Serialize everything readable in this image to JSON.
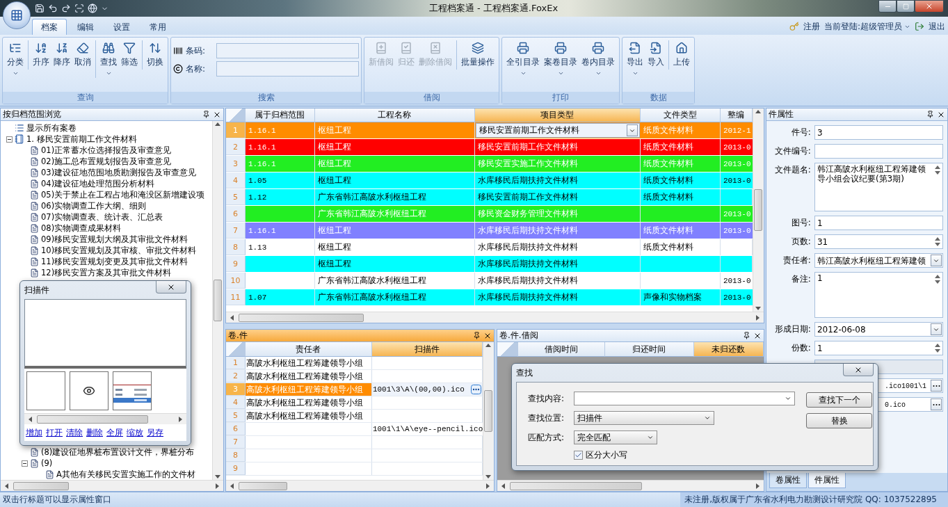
{
  "window": {
    "title": "工程档案通 - 工程档案通.FoxEx"
  },
  "ribbon": {
    "tabs": [
      {
        "label": "档案",
        "selected": true
      },
      {
        "label": "编辑",
        "selected": false
      },
      {
        "label": "设置",
        "selected": false
      },
      {
        "label": "常用",
        "selected": false
      }
    ],
    "user_bar": {
      "register": "注册",
      "login": "当前登陆:超级管理员",
      "logout": "退出"
    },
    "groups": [
      {
        "title": "查询",
        "kind": "buttons",
        "buttons": [
          {
            "label": "分类",
            "dropdown": true,
            "disabled": false,
            "separated": false
          },
          {
            "label": "升序",
            "dropdown": false,
            "disabled": false,
            "separated": true
          },
          {
            "label": "降序",
            "dropdown": false,
            "disabled": false,
            "separated": false
          },
          {
            "label": "取消",
            "dropdown": false,
            "disabled": false,
            "separated": false
          },
          {
            "label": "查找",
            "dropdown": true,
            "disabled": false,
            "separated": true
          },
          {
            "label": "筛选",
            "dropdown": false,
            "disabled": false,
            "separated": false
          },
          {
            "label": "切换",
            "dropdown": false,
            "disabled": false,
            "separated": true
          }
        ]
      },
      {
        "title": "搜索",
        "kind": "fields",
        "fields": [
          {
            "label": "条码:"
          },
          {
            "label": "名称:"
          }
        ]
      },
      {
        "title": "借阅",
        "kind": "buttons",
        "buttons": [
          {
            "label": "新借阅",
            "dropdown": false,
            "disabled": true,
            "separated": false
          },
          {
            "label": "归还",
            "dropdown": false,
            "disabled": true,
            "separated": false
          },
          {
            "label": "删除借阅",
            "dropdown": false,
            "disabled": true,
            "separated": false
          },
          {
            "label": "批量操作",
            "dropdown": false,
            "disabled": false,
            "separated": true
          }
        ]
      },
      {
        "title": "打印",
        "kind": "buttons",
        "buttons": [
          {
            "label": "全引目录",
            "dropdown": true,
            "disabled": false,
            "separated": false
          },
          {
            "label": "案卷目录",
            "dropdown": true,
            "disabled": false,
            "separated": false
          },
          {
            "label": "卷内目录",
            "dropdown": true,
            "disabled": false,
            "separated": false
          }
        ]
      },
      {
        "title": "数据",
        "kind": "buttons",
        "buttons": [
          {
            "label": "导出",
            "dropdown": true,
            "disabled": false,
            "separated": false
          },
          {
            "label": "导入",
            "dropdown": false,
            "disabled": false,
            "separated": false
          },
          {
            "label": "上传",
            "dropdown": false,
            "disabled": false,
            "separated": true
          }
        ]
      }
    ]
  },
  "tree": {
    "title": "按归档范围浏览",
    "items": [
      {
        "label": "显示所有案卷",
        "kind": "root"
      },
      {
        "label": "1.  移民安置前期工作文件材料",
        "kind": "folder",
        "expanded": true,
        "children": [
          {
            "label": "01)正常蓄水位选择报告及审查意见",
            "kind": "doc"
          },
          {
            "label": "02)施工总布置规划报告及审查意见",
            "kind": "doc"
          },
          {
            "label": "03)建设征地范围地质勘测报告及审查意见",
            "kind": "doc"
          },
          {
            "label": "04)建设征地处理范围分析材料",
            "kind": "doc"
          },
          {
            "label": "05)关于禁止在工程占地和淹没区新增建设项",
            "kind": "doc"
          },
          {
            "label": "06)实物调查工作大纲、细则",
            "kind": "doc"
          },
          {
            "label": "07)实物调查表、统计表、汇总表",
            "kind": "doc"
          },
          {
            "label": "08)实物调查成果材料",
            "kind": "doc"
          },
          {
            "label": "09)移民安置规划大纲及其审批文件材料",
            "kind": "doc"
          },
          {
            "label": "10)移民安置规划及其审核、审批文件材料",
            "kind": "doc"
          },
          {
            "label": "11)移民安置规划变更及其审批文件材料",
            "kind": "doc"
          },
          {
            "label": "12)移民安置方案及其审批文件材料",
            "kind": "doc"
          }
        ]
      }
    ],
    "lower_items": [
      {
        "label": "(8)建设征地界桩布置设计文件，界桩分布",
        "kind": "doc"
      },
      {
        "label": "(9)",
        "kind": "doc",
        "expanded": true,
        "children": [
          {
            "label": "A其他有关移民安置实施工作的文件材",
            "kind": "doc"
          }
        ]
      }
    ]
  },
  "scan_window": {
    "title": "扫描件",
    "thumbnails": [
      {
        "kind": "blank"
      },
      {
        "kind": "icon"
      },
      {
        "kind": "picture"
      }
    ],
    "links": [
      "增加",
      "打开",
      "清除",
      "删除",
      "全屏",
      "缩放",
      "另存"
    ]
  },
  "grid": {
    "columns": [
      {
        "label": "属于归档范围",
        "selected": false
      },
      {
        "label": "工程名称",
        "selected": false
      },
      {
        "label": "项目类型",
        "selected": true
      },
      {
        "label": "文件类型",
        "selected": false
      },
      {
        "label": "整编",
        "selected": false
      }
    ],
    "rows": [
      {
        "number": "1",
        "selected": true,
        "editing": true,
        "color": "#ff8c00",
        "light_text": true,
        "cells": [
          "1.16.1",
          "枢纽工程",
          "移民安置前期工作文件材料",
          "纸质文件材料",
          "2012-1"
        ]
      },
      {
        "number": "2",
        "selected": false,
        "editing": false,
        "color": "#ff0000",
        "light_text": true,
        "cells": [
          "1.16.1",
          "枢纽工程",
          "移民安置前期工作文件材料",
          "纸质文件材料",
          "2013-0"
        ]
      },
      {
        "number": "3",
        "selected": false,
        "editing": false,
        "color": "#22ee22",
        "light_text": true,
        "cells": [
          "1.16.1",
          "枢纽工程",
          "移民安置实施工作文件材料",
          "纸质文件材料",
          "2013-0"
        ]
      },
      {
        "number": "4",
        "selected": false,
        "editing": false,
        "color": "#00ffff",
        "light_text": false,
        "cells": [
          "1.05",
          "枢纽工程",
          "水库移民后期扶持文件材料",
          "纸质文件材料",
          "2013-0"
        ]
      },
      {
        "number": "5",
        "selected": false,
        "editing": false,
        "color": "#00ffff",
        "light_text": false,
        "cells": [
          "1.12",
          "广东省韩江高陂水利枢纽工程",
          "移民安置前期工作文件材料",
          "纸质文件材料",
          ""
        ]
      },
      {
        "number": "6",
        "selected": false,
        "editing": false,
        "color": "#22ee22",
        "light_text": true,
        "cells": [
          "",
          "广东省韩江高陂水利枢纽工程",
          "移民资金财务管理文件材料",
          "",
          "2013-0"
        ]
      },
      {
        "number": "7",
        "selected": false,
        "editing": false,
        "color": "#8080ff",
        "light_text": true,
        "cells": [
          "1.16.1",
          "枢纽工程",
          "水库移民后期扶持文件材料",
          "纸质文件材料",
          "2013-0"
        ]
      },
      {
        "number": "8",
        "selected": false,
        "editing": false,
        "color": "#ffffff",
        "light_text": false,
        "cells": [
          "1.13",
          "枢纽工程",
          "水库移民后期扶持文件材料",
          "纸质文件材料",
          ""
        ]
      },
      {
        "number": "9",
        "selected": false,
        "editing": false,
        "color": "#00ffff",
        "light_text": false,
        "cells": [
          "",
          "枢纽工程",
          "水库移民后期扶持文件材料",
          "",
          ""
        ]
      },
      {
        "number": "10",
        "selected": false,
        "editing": false,
        "color": "#ffffff",
        "light_text": false,
        "cells": [
          "",
          "广东省韩江高陂水利枢纽工程",
          "水库移民后期扶持文件材料",
          "",
          "2013-0"
        ]
      },
      {
        "number": "11",
        "selected": false,
        "editing": false,
        "color": "#00ffff",
        "light_text": false,
        "cells": [
          "1.07",
          "广东省韩江高陂水利枢纽工程",
          "水库移民后期扶持文件材料",
          "声像和实物档案",
          "2013-0"
        ]
      }
    ]
  },
  "files_panel": {
    "title": "卷.件",
    "columns": [
      {
        "label": "责任者",
        "selected": false
      },
      {
        "label": "扫描件",
        "selected": true
      }
    ],
    "rows": [
      {
        "number": "1",
        "selected": false,
        "browse": false,
        "cells": [
          "高陂水利枢纽工程筹建领导小组",
          ""
        ]
      },
      {
        "number": "2",
        "selected": false,
        "browse": false,
        "cells": [
          "高陂水利枢纽工程筹建领导小组",
          ""
        ]
      },
      {
        "number": "3",
        "selected": true,
        "browse": true,
        "cells": [
          "高陂水利枢纽工程筹建领导小组",
          "1001\\3\\A\\(00,00).ico"
        ]
      },
      {
        "number": "4",
        "selected": false,
        "browse": false,
        "cells": [
          "高陂水利枢纽工程筹建领导小组",
          ""
        ]
      },
      {
        "number": "5",
        "selected": false,
        "browse": false,
        "cells": [
          "高陂水利枢纽工程筹建领导小组",
          ""
        ]
      },
      {
        "number": "6",
        "selected": false,
        "browse": false,
        "cells": [
          "",
          "1001\\1\\A\\eye--pencil.ico"
        ]
      },
      {
        "number": "7",
        "selected": false,
        "browse": false,
        "cells": [
          "",
          ""
        ]
      },
      {
        "number": "8",
        "selected": false,
        "browse": false,
        "cells": [
          "",
          ""
        ]
      },
      {
        "number": "9",
        "selected": false,
        "browse": false,
        "cells": [
          "",
          ""
        ]
      }
    ]
  },
  "loans_panel": {
    "title": "卷.件.借阅",
    "columns": [
      {
        "label": "借阅时间",
        "selected": false
      },
      {
        "label": "归还时间",
        "selected": false
      },
      {
        "label": "未归还数",
        "selected": true
      }
    ]
  },
  "find_dialog": {
    "title": "查找",
    "fields": [
      {
        "label": "查找内容:",
        "kind": "combo"
      },
      {
        "label": "查找位置:",
        "kind": "select",
        "value": "扫描件"
      },
      {
        "label": "匹配方式:",
        "kind": "select",
        "value": "完全匹配"
      }
    ],
    "checkbox": {
      "label": "区分大小写",
      "checked": true
    },
    "buttons": [
      "查找下一个",
      "替换"
    ]
  },
  "properties": {
    "title": "件属性",
    "fields": [
      {
        "label": "件号:",
        "kind": "text",
        "value": "3"
      },
      {
        "label": "文件编号:",
        "kind": "text"
      },
      {
        "label": "文件题名:",
        "kind": "memo",
        "value": "韩江高陂水利枢纽工程筹建领导小组会议纪要(第3期)"
      },
      {
        "label": "图号:",
        "kind": "text",
        "value": "1"
      },
      {
        "label": "页数:",
        "kind": "spin",
        "value": "31"
      },
      {
        "label": "责任者:",
        "kind": "combo",
        "value": "韩江高陂水利枢纽工程筹建领"
      },
      {
        "label": "备注:",
        "kind": "memo",
        "value": "1"
      },
      {
        "label": "形成日期:",
        "kind": "combo",
        "value": "2012-06-08"
      },
      {
        "label": "份数:",
        "kind": "spin",
        "value": "1"
      },
      {
        "kind": "disabled"
      },
      {
        "kind": "browse",
        "value": ".ico1001\\1"
      },
      {
        "kind": "browse",
        "value": "0.ico"
      }
    ],
    "tabs": [
      {
        "label": "卷属性",
        "selected": false
      },
      {
        "label": "件属性",
        "selected": true
      }
    ]
  },
  "status_bar": {
    "hint": "双击行标题可以显示属性窗口",
    "copyright": "未注册,版权属于广东省水利电力勘测设计研究院 QQ: 1037522895"
  }
}
